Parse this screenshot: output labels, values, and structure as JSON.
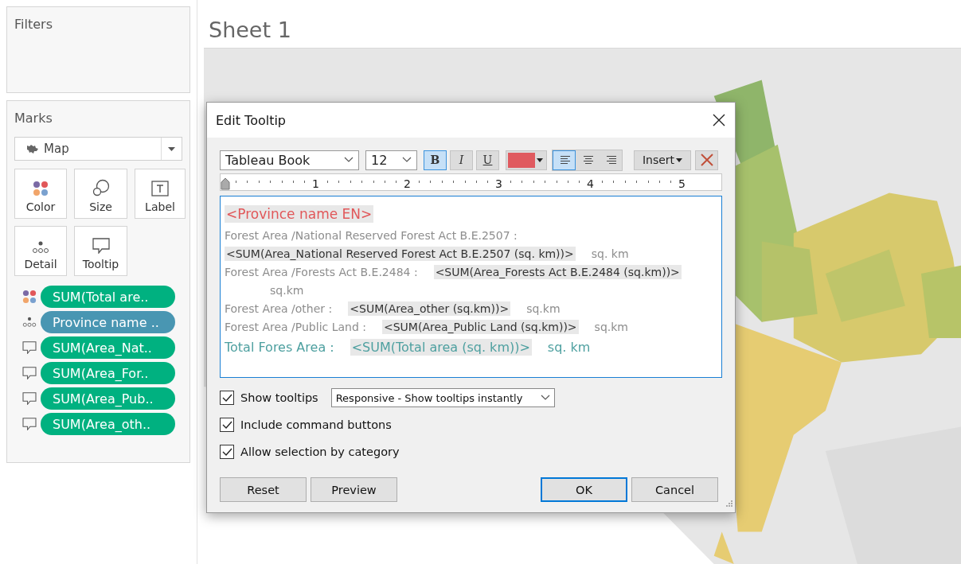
{
  "filters": {
    "title": "Filters"
  },
  "marks": {
    "title": "Marks",
    "mark_type": "Map",
    "cards": [
      {
        "label": "Color",
        "kind": "color"
      },
      {
        "label": "Size",
        "kind": "size"
      },
      {
        "label": "Label",
        "kind": "label"
      },
      {
        "label": "Detail",
        "kind": "detail"
      },
      {
        "label": "Tooltip",
        "kind": "tooltip"
      }
    ],
    "pills": [
      {
        "kind": "color",
        "text": "SUM(Total are..",
        "color": "#00b180"
      },
      {
        "kind": "detail",
        "text": "Province name ..",
        "color": "#4996b2"
      },
      {
        "kind": "tooltip",
        "text": "SUM(Area_Nat..",
        "color": "#00b180"
      },
      {
        "kind": "tooltip",
        "text": "SUM(Area_For..",
        "color": "#00b180"
      },
      {
        "kind": "tooltip",
        "text": "SUM(Area_Pub..",
        "color": "#00b180"
      },
      {
        "kind": "tooltip",
        "text": "SUM(Area_oth..",
        "color": "#00b180"
      }
    ]
  },
  "sheet": {
    "title": "Sheet 1"
  },
  "dialog": {
    "title": "Edit Tooltip",
    "toolbar": {
      "font": "Tableau Book",
      "size": "12",
      "styles": [
        {
          "label": "B",
          "kind": "bold",
          "selected": true
        },
        {
          "label": "I",
          "kind": "italic",
          "selected": false
        },
        {
          "label": "U",
          "kind": "underline",
          "selected": false
        }
      ],
      "color": "#e05a5f",
      "align": [
        {
          "kind": "left",
          "selected": true
        },
        {
          "kind": "center",
          "selected": false
        },
        {
          "kind": "right",
          "selected": false
        }
      ],
      "insert": "Insert"
    },
    "ruler": [
      "1",
      "2",
      "3",
      "4",
      "5"
    ],
    "lines": [
      {
        "kind": "header",
        "segments": [
          {
            "kind": "field",
            "text": "<Province name EN>"
          }
        ]
      },
      {
        "kind": "body",
        "segments": [
          {
            "kind": "text",
            "text": "Forest Area /National Reserved Forest Act B.E.2507 :"
          }
        ]
      },
      {
        "kind": "body",
        "segments": [
          {
            "kind": "field",
            "text": "<SUM(Area_National Reserved Forest Act B.E.2507 (sq. km))>"
          },
          {
            "kind": "text",
            "text": "sq. km"
          }
        ]
      },
      {
        "kind": "body",
        "segments": [
          {
            "kind": "text",
            "text": "Forest Area /Forests Act B.E.2484 :"
          },
          {
            "kind": "field",
            "text": "<SUM(Area_Forests Act B.E.2484 (sq.km))>"
          }
        ]
      },
      {
        "kind": "body",
        "segments": [
          {
            "kind": "text",
            "text": "sq.km"
          }
        ]
      },
      {
        "kind": "body",
        "segments": [
          {
            "kind": "text",
            "text": "Forest Area /other :"
          },
          {
            "kind": "field",
            "text": "<SUM(Area_other (sq.km))>"
          },
          {
            "kind": "text",
            "text": "sq.km"
          }
        ]
      },
      {
        "kind": "body",
        "segments": [
          {
            "kind": "text",
            "text": "Forest Area /Public Land :"
          },
          {
            "kind": "field",
            "text": "<SUM(Area_Public Land (sq.km))>"
          },
          {
            "kind": "text",
            "text": "sq.km"
          }
        ]
      },
      {
        "kind": "total",
        "segments": [
          {
            "kind": "text",
            "text": "Total Fores Area :"
          },
          {
            "kind": "field",
            "text": "<SUM(Total area (sq. km))>"
          },
          {
            "kind": "text",
            "text": "sq. km"
          }
        ]
      }
    ],
    "options": [
      {
        "label": "Show tooltips",
        "checked": true,
        "dropdown": "Responsive - Show tooltips instantly"
      },
      {
        "label": "Include command buttons",
        "checked": true
      },
      {
        "label": "Allow selection by category",
        "checked": true
      }
    ],
    "buttons": [
      {
        "label": "Reset",
        "default": false
      },
      {
        "label": "Preview",
        "default": false
      },
      {
        "label": "OK",
        "default": true
      },
      {
        "label": "Cancel",
        "default": false
      }
    ]
  }
}
